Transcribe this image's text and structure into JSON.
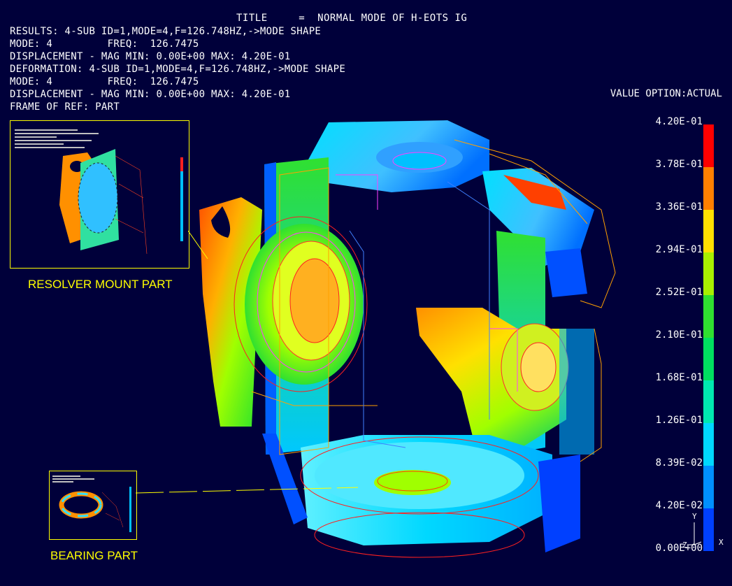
{
  "title_line": "TITLE     =  NORMAL MODE OF H-EOTS IG",
  "header_lines": [
    "RESULTS: 4-SUB ID=1,MODE=4,F=126.748HZ,->MODE SHAPE",
    "MODE: 4         FREQ:  126.7475",
    "DISPLACEMENT - MAG MIN: 0.00E+00 MAX: 4.20E-01",
    "DEFORMATION: 4-SUB ID=1,MODE=4,F=126.748HZ,->MODE SHAPE",
    "MODE: 4         FREQ:  126.7475",
    "DISPLACEMENT - MAG MIN: 0.00E+00 MAX: 4.20E-01",
    "FRAME OF REF: PART"
  ],
  "value_option": "VALUE OPTION:ACTUAL",
  "legend": {
    "labels": [
      "4.20E-01",
      "3.78E-01",
      "3.36E-01",
      "2.94E-01",
      "2.52E-01",
      "2.10E-01",
      "1.68E-01",
      "1.26E-01",
      "8.39E-02",
      "4.20E-02",
      "0.00E+00"
    ],
    "colors": [
      "#ff0000",
      "#ff7f00",
      "#ffe000",
      "#a8f000",
      "#30e030",
      "#00e060",
      "#00e8b0",
      "#00d8ff",
      "#0090ff",
      "#0040ff"
    ]
  },
  "insets": {
    "resolver_caption": "RESOLVER MOUNT PART",
    "bearing_caption": "BEARING PART"
  },
  "axes": {
    "y": "Y",
    "z": "Z",
    "x": "X"
  }
}
